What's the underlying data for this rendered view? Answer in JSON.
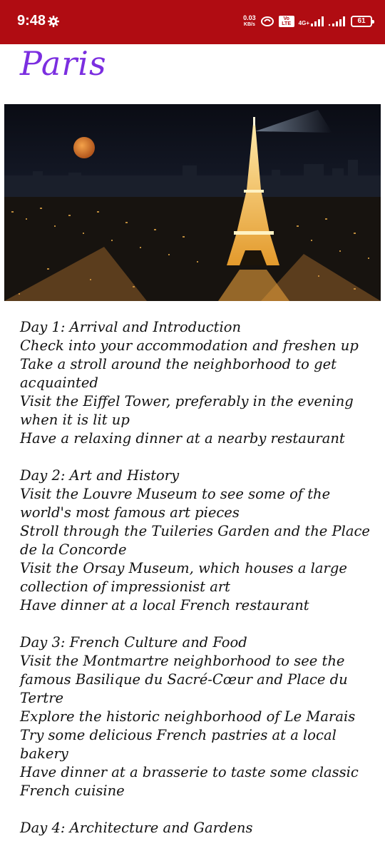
{
  "status_bar": {
    "time": "9:48",
    "net_speed_value": "0.03",
    "net_speed_unit": "KB/s",
    "volte_label": "Vo LTE",
    "network_label": "4G+",
    "battery_level": "61"
  },
  "page": {
    "title": "Paris"
  },
  "colors": {
    "status_bar": "#b00c12",
    "title": "#7b2ee0",
    "text": "#111111"
  },
  "itinerary": [
    {
      "heading": "Day 1: Arrival and Introduction",
      "items": [
        "Check into your accommodation and freshen up",
        "Take a stroll around the neighborhood to get acquainted",
        "Visit the Eiffel Tower, preferably in the evening when it is lit up",
        "Have a relaxing dinner at a nearby restaurant"
      ]
    },
    {
      "heading": "Day 2: Art and History",
      "items": [
        "Visit the Louvre Museum to see some of the world's most famous art pieces",
        "Stroll through the Tuileries Garden and the Place de la Concorde",
        "Visit the Orsay Museum, which houses a large collection of impressionist art",
        "Have dinner at a local French restaurant"
      ]
    },
    {
      "heading": "Day 3: French Culture and Food",
      "items": [
        "Visit the Montmartre neighborhood to see the famous Basilique du Sacré-Cœur and Place du Tertre",
        "Explore the historic neighborhood of Le Marais",
        "Try some delicious French pastries at a local bakery",
        "Have dinner at a brasserie to taste some classic French cuisine"
      ]
    },
    {
      "heading": "Day 4: Architecture and Gardens",
      "items": []
    }
  ]
}
